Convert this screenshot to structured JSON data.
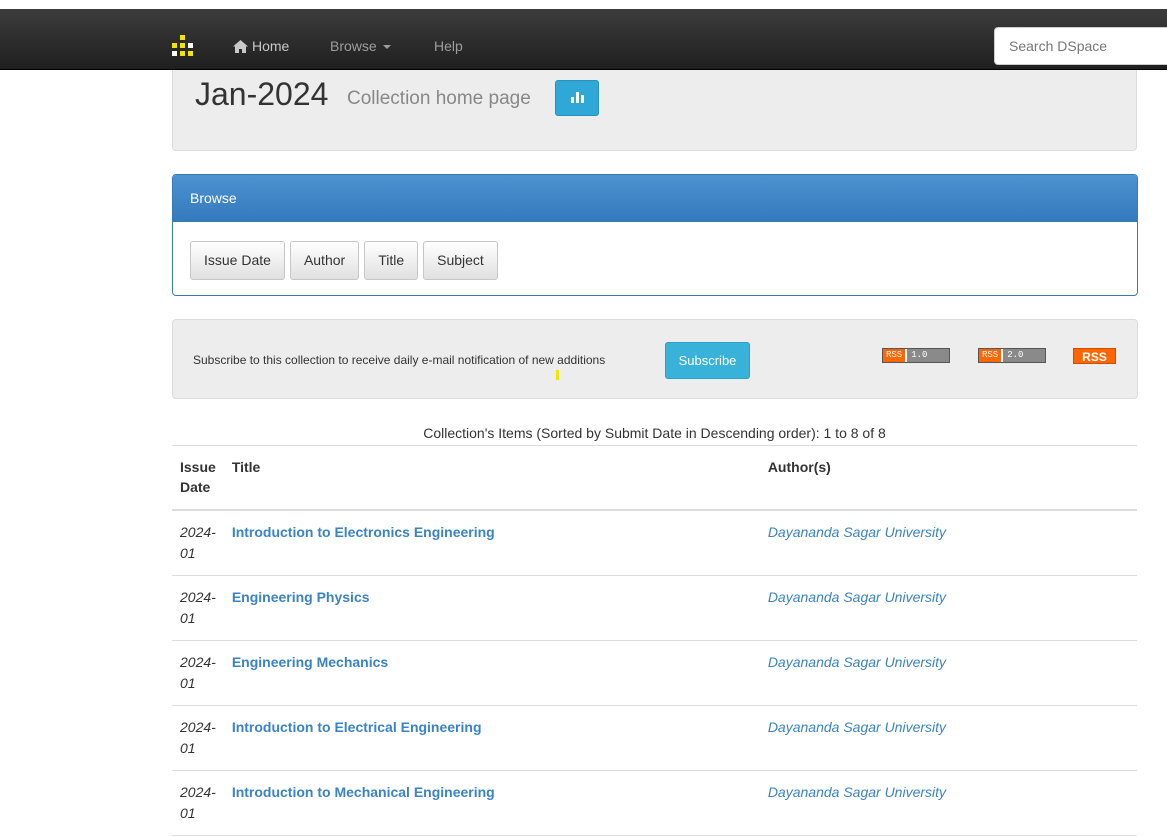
{
  "nav": {
    "home": "Home",
    "browse": "Browse",
    "help": "Help",
    "search_placeholder": "Search DSpace"
  },
  "collection": {
    "title": "Jan-2024",
    "subtitle": "Collection home page"
  },
  "browse_panel": {
    "heading": "Browse",
    "buttons": [
      "Issue Date",
      "Author",
      "Title",
      "Subject"
    ]
  },
  "subscribe": {
    "text": "Subscribe to this collection to receive daily e-mail notification of new additions",
    "button": "Subscribe",
    "rss1": {
      "left": "RSS",
      "right": "1.0"
    },
    "rss2": {
      "left": "RSS",
      "right": "2.0"
    },
    "rss3": "RSS"
  },
  "items": {
    "caption": "Collection's Items (Sorted by Submit Date in Descending order): 1 to 8 of 8",
    "headers": {
      "date": "Issue Date",
      "title": "Title",
      "author": "Author(s)"
    },
    "rows": [
      {
        "date": "2024-01",
        "title": "Introduction to Electronics Engineering",
        "author": "Dayananda Sagar University"
      },
      {
        "date": "2024-01",
        "title": "Engineering Physics",
        "author": "Dayananda Sagar University"
      },
      {
        "date": "2024-01",
        "title": "Engineering Mechanics",
        "author": "Dayananda Sagar University"
      },
      {
        "date": "2024-01",
        "title": "Introduction to Electrical Engineering",
        "author": "Dayananda Sagar University"
      },
      {
        "date": "2024-01",
        "title": "Introduction to Mechanical Engineering",
        "author": "Dayananda Sagar University"
      }
    ]
  },
  "colors": {
    "navbar": "#222222",
    "link": "#3a83c5",
    "panel_primary": "#337ab7",
    "info_button": "#38b2d9",
    "rss_orange": "#ff6600"
  }
}
